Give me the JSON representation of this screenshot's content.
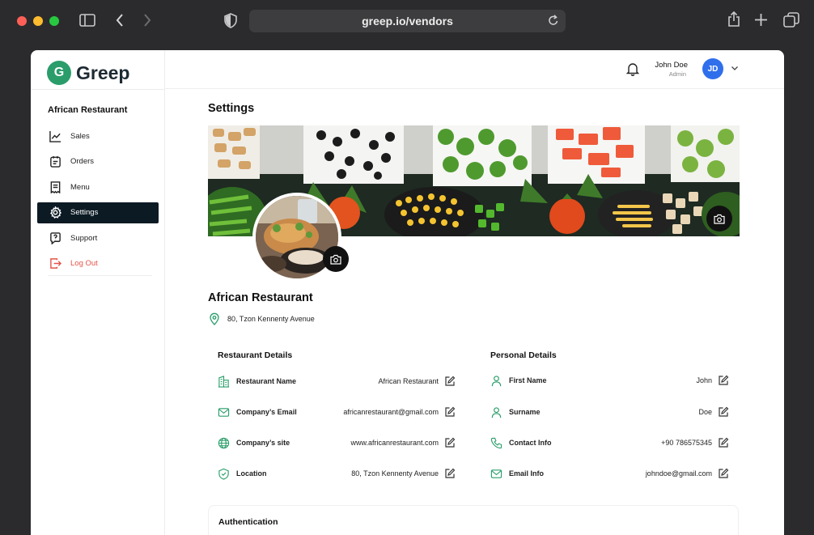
{
  "browser": {
    "url": "greep.io/vendors"
  },
  "app": {
    "logo_letter": "G",
    "name": "Greep"
  },
  "sidebar": {
    "store_name": "African Restaurant",
    "items": [
      {
        "label": "Sales",
        "icon": "chart-line-icon"
      },
      {
        "label": "Orders",
        "icon": "clipboard-icon"
      },
      {
        "label": "Menu",
        "icon": "receipt-icon"
      },
      {
        "label": "Settings",
        "icon": "gear-icon"
      },
      {
        "label": "Support",
        "icon": "help-chat-icon"
      },
      {
        "label": "Log Out",
        "icon": "logout-icon"
      }
    ]
  },
  "header": {
    "user_name": "John Doe",
    "user_role": "Admin",
    "initials": "JD"
  },
  "main": {
    "title": "Settings",
    "restaurant_name": "African Restaurant",
    "address": "80, Tzon Kennenty Avenue",
    "restaurant_details": {
      "title": "Restaurant Details",
      "rows": [
        {
          "label": "Restaurant Name",
          "value": "African Restaurant",
          "icon": "building-icon"
        },
        {
          "label": "Company’s Email",
          "value": "africanrestaurant@gmail.com",
          "icon": "mail-icon"
        },
        {
          "label": "Company’s site",
          "value": "www.africanrestaurant.com",
          "icon": "globe-icon"
        },
        {
          "label": "Location",
          "value": "80, Tzon Kennenty Avenue",
          "icon": "shield-check-icon"
        }
      ]
    },
    "personal_details": {
      "title": "Personal Details",
      "rows": [
        {
          "label": "First Name",
          "value": "John",
          "icon": "user-icon"
        },
        {
          "label": "Surname",
          "value": "Doe",
          "icon": "user-icon"
        },
        {
          "label": "Contact Info",
          "value": "+90 786575345",
          "icon": "phone-icon"
        },
        {
          "label": "Email Info",
          "value": "johndoe@gmail.com",
          "icon": "mail-icon"
        }
      ]
    },
    "authentication": {
      "title": "Authentication"
    }
  },
  "colors": {
    "brand": "#2a9d6a",
    "active_nav": "#0c1a24",
    "logout": "#e5534b",
    "avatar": "#2f6fec"
  }
}
